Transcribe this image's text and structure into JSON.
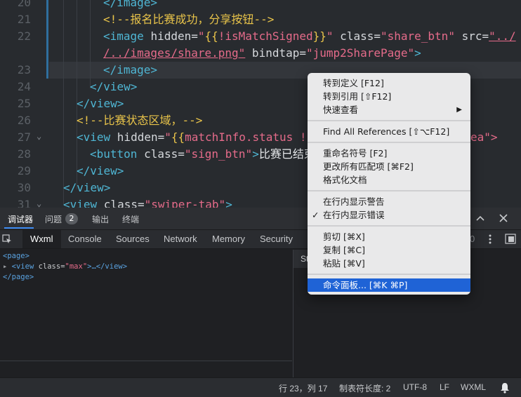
{
  "editor": {
    "line_numbers": [
      "20",
      "21",
      "22",
      "",
      "23",
      "24",
      "25",
      "26",
      "27",
      "28",
      "29",
      "30",
      "31"
    ],
    "lines": [
      {
        "segments": [
          [
            "tag",
            "</image>"
          ]
        ]
      },
      {
        "segments": [
          [
            "comment",
            "<!--报名比赛成功，分享按钮-->"
          ]
        ]
      },
      {
        "segments": [
          [
            "tag",
            "<image "
          ],
          [
            "attr",
            "hidden="
          ],
          [
            "str",
            "\""
          ],
          [
            "brace",
            "{{"
          ],
          [
            "str",
            "!isMatchSigned"
          ],
          [
            "brace",
            "}}"
          ],
          [
            "str",
            "\""
          ],
          [
            "attr",
            " class="
          ],
          [
            "str",
            "\"share_btn\""
          ],
          [
            "attr",
            " src="
          ],
          [
            "str",
            "\"../"
          ]
        ]
      },
      {
        "segments": [
          [
            "str",
            "/../images/share.png\""
          ],
          [
            "attr",
            " bindtap="
          ],
          [
            "str",
            "\"jump2SharePage\""
          ],
          [
            "tag",
            ">"
          ]
        ]
      },
      {
        "segments": [
          [
            "tag",
            "</image>"
          ]
        ]
      },
      {
        "segments": [
          [
            "tag",
            "</view>"
          ]
        ]
      },
      {
        "segments": [
          [
            "tag",
            "</view>"
          ]
        ]
      },
      {
        "segments": [
          [
            "comment",
            "<!--比赛状态区域，-->"
          ]
        ]
      },
      {
        "segments": [
          [
            "tag",
            "<view "
          ],
          [
            "attr",
            "hidden="
          ],
          [
            "str",
            "\""
          ],
          [
            "brace",
            "{{"
          ],
          [
            "str",
            "matchInfo.status !"
          ]
        ]
      },
      {
        "segments": [
          [
            "tag",
            "<button "
          ],
          [
            "attr",
            "class="
          ],
          [
            "str",
            "\"sign_btn\""
          ],
          [
            "tag",
            ">"
          ],
          [
            "plain",
            "比赛已结束"
          ]
        ]
      },
      {
        "segments": [
          [
            "tag",
            "</view>"
          ]
        ]
      },
      {
        "segments": [
          [
            "tag",
            "</view>"
          ]
        ]
      },
      {
        "segments": [
          [
            "tag",
            "<view "
          ],
          [
            "attr",
            "class="
          ],
          [
            "str",
            "\"swiper-tab\""
          ],
          [
            "tag",
            ">"
          ]
        ]
      }
    ],
    "line27_tail": "ea\">"
  },
  "devtools": {
    "top_tabs": [
      "调试器",
      "问题",
      "输出",
      "终端"
    ],
    "problems_count": "2",
    "panel_tabs": [
      "Wxml",
      "Console",
      "Sources",
      "Network",
      "Memory",
      "Security"
    ],
    "wxml_tree": {
      "open_page": "<page>",
      "view_tag_open": "<view ",
      "view_attr": "class=",
      "view_value": "\"max\"",
      "view_rest": ">…</view>",
      "close_page": "</page>"
    },
    "side_header": "St"
  },
  "context_menu": {
    "groups": [
      [
        {
          "label": "转到定义 [F12]"
        },
        {
          "label": "转到引用 [⇧F12]"
        },
        {
          "label": "快速查看",
          "submenu": true
        }
      ],
      [
        {
          "label": "Find All References [⇧⌥F12]"
        }
      ],
      [
        {
          "label": "重命名符号 [F2]"
        },
        {
          "label": "更改所有匹配项 [⌘F2]"
        },
        {
          "label": "格式化文档"
        }
      ],
      [
        {
          "label": "在行内显示警告"
        },
        {
          "label": "在行内显示错误",
          "checked": true
        }
      ],
      [
        {
          "label": "剪切 [⌘X]"
        },
        {
          "label": "复制 [⌘C]"
        },
        {
          "label": "粘贴 [⌘V]"
        }
      ],
      [
        {
          "label": "命令面板... [⌘K ⌘P]",
          "selected": true
        }
      ]
    ]
  },
  "status_bar": {
    "position": "行 23，列 17",
    "tab_size": "制表符长度: 2",
    "encoding": "UTF-8",
    "eol": "LF",
    "language": "WXML"
  }
}
